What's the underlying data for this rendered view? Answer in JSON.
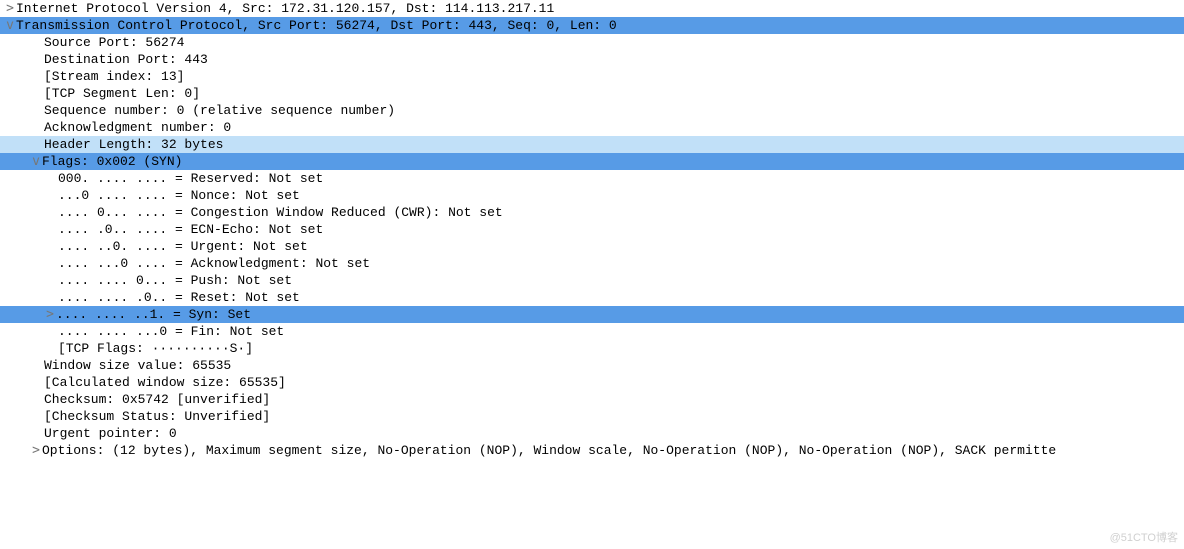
{
  "ip_line": "Internet Protocol Version 4, Src: 172.31.120.157, Dst: 114.113.217.11",
  "tcp_line": "Transmission Control Protocol, Src Port: 56274, Dst Port: 443, Seq: 0, Len: 0",
  "fields": {
    "source_port": "Source Port: 56274",
    "dest_port": "Destination Port: 443",
    "stream_index": "[Stream index: 13]",
    "tcp_seg_len": "[TCP Segment Len: 0]",
    "seq_num": "Sequence number: 0    (relative sequence number)",
    "ack_num": "Acknowledgment number: 0",
    "header_len": "Header Length: 32 bytes",
    "flags_header": "Flags: 0x002 (SYN)",
    "flag_reserved": "000. .... .... = Reserved: Not set",
    "flag_nonce": "...0 .... .... = Nonce: Not set",
    "flag_cwr": ".... 0... .... = Congestion Window Reduced (CWR): Not set",
    "flag_ecn": ".... .0.. .... = ECN-Echo: Not set",
    "flag_urg": ".... ..0. .... = Urgent: Not set",
    "flag_ack": ".... ...0 .... = Acknowledgment: Not set",
    "flag_psh": ".... .... 0... = Push: Not set",
    "flag_rst": ".... .... .0.. = Reset: Not set",
    "flag_syn": ".... .... ..1. = Syn: Set",
    "flag_fin": ".... .... ...0 = Fin: Not set",
    "tcp_flags_str": "[TCP Flags: ··········S·]",
    "window_size": "Window size value: 65535",
    "calc_window": "[Calculated window size: 65535]",
    "checksum": "Checksum: 0x5742 [unverified]",
    "checksum_status": "[Checksum Status: Unverified]",
    "urgent_ptr": "Urgent pointer: 0",
    "options": "Options: (12 bytes), Maximum segment size, No-Operation (NOP), Window scale, No-Operation (NOP), No-Operation (NOP), SACK permitte"
  },
  "watermark": "@51CTO博客"
}
